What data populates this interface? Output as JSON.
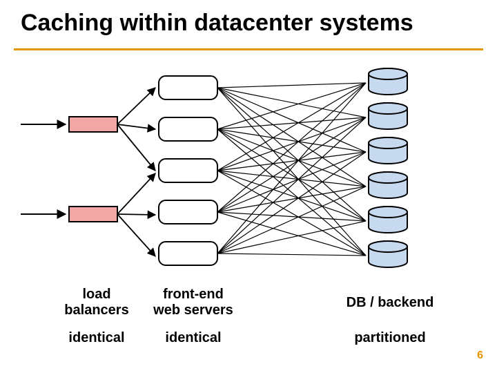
{
  "title": "Caching within datacenter systems",
  "columns": {
    "lb": {
      "label": "load\nbalancers",
      "sub": "identical"
    },
    "web": {
      "label": "front-end\nweb servers",
      "sub": "identical"
    },
    "db": {
      "label": "DB / backend",
      "sub": "partitioned"
    }
  },
  "slide_number": "6",
  "colors": {
    "rule": "#e69500",
    "lb_fill": "#f2a6a6",
    "db_fill": "#c7d9ef"
  }
}
